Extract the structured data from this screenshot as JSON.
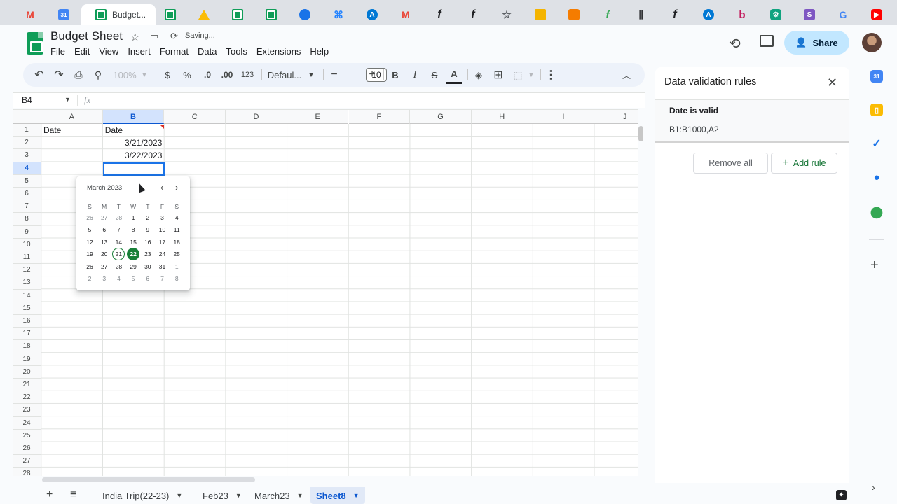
{
  "browser_tabs": [
    {
      "icon": "gmail-icon",
      "glyph": "M"
    },
    {
      "icon": "calendar-icon",
      "glyph": "31"
    },
    {
      "icon": "sheets-icon",
      "title": "Budget...",
      "active": true
    },
    {
      "icon": "sheets-icon"
    },
    {
      "icon": "drive-icon"
    },
    {
      "icon": "sheets-icon"
    },
    {
      "icon": "sheets-icon"
    },
    {
      "icon": "hexagon-icon"
    },
    {
      "icon": "jira-icon",
      "glyph": "⌘"
    },
    {
      "icon": "azure-icon",
      "glyph": "A"
    },
    {
      "icon": "gmail-icon",
      "glyph": "M"
    },
    {
      "icon": "f-icon",
      "glyph": "f"
    },
    {
      "icon": "f-icon",
      "glyph": "f"
    },
    {
      "icon": "star-icon",
      "glyph": "☆"
    },
    {
      "icon": "box-icon"
    },
    {
      "icon": "cube-icon"
    },
    {
      "icon": "green-f-icon",
      "glyph": "f"
    },
    {
      "icon": "bars-icon",
      "glyph": "⫼"
    },
    {
      "icon": "f-icon",
      "glyph": "f"
    },
    {
      "icon": "azure-icon",
      "glyph": "A"
    },
    {
      "icon": "b-icon",
      "glyph": "b"
    },
    {
      "icon": "chatgpt-icon",
      "glyph": "⚙"
    },
    {
      "icon": "s-icon",
      "glyph": "S"
    },
    {
      "icon": "google-icon",
      "glyph": "G"
    },
    {
      "icon": "youtube-icon",
      "glyph": "▶"
    }
  ],
  "doc": {
    "title": "Budget Sheet",
    "status": "Saving...",
    "menu": [
      "File",
      "Edit",
      "View",
      "Insert",
      "Format",
      "Data",
      "Tools",
      "Extensions",
      "Help"
    ],
    "share_label": "Share"
  },
  "toolbar": {
    "zoom": "100%",
    "currency": "$",
    "percent": "%",
    "decrease_decimal": ".0",
    "increase_decimal": ".00",
    "more_formats": "123",
    "font": "Defaul...",
    "font_size": "10",
    "bold": "B",
    "italic": "I",
    "strike": "S",
    "text_color": "A"
  },
  "formula_bar": {
    "cell_ref": "B4",
    "fx": "fx"
  },
  "grid": {
    "columns": [
      "A",
      "B",
      "C",
      "D",
      "E",
      "F",
      "G",
      "H",
      "I",
      "J"
    ],
    "selected_column": "B",
    "rows": [
      "1",
      "2",
      "3",
      "4",
      "5",
      "6",
      "7",
      "8",
      "9",
      "10",
      "11",
      "12",
      "13",
      "14",
      "15",
      "16",
      "17",
      "18",
      "19",
      "20",
      "21",
      "22",
      "23",
      "24",
      "25",
      "26",
      "27",
      "28"
    ],
    "selected_row": "4",
    "cells": {
      "A1": "Date",
      "B1": "Date",
      "B2": "3/21/2023",
      "B3": "3/22/2023"
    }
  },
  "date_picker": {
    "month_label": "March 2023",
    "weekdays": [
      "S",
      "M",
      "T",
      "W",
      "T",
      "F",
      "S"
    ],
    "weeks": [
      [
        [
          "26",
          1
        ],
        [
          "27",
          1
        ],
        [
          "28",
          1
        ],
        [
          "1",
          0
        ],
        [
          "2",
          0
        ],
        [
          "3",
          0
        ],
        [
          "4",
          0
        ]
      ],
      [
        [
          "5",
          0
        ],
        [
          "6",
          0
        ],
        [
          "7",
          0
        ],
        [
          "8",
          0
        ],
        [
          "9",
          0
        ],
        [
          "10",
          0
        ],
        [
          "11",
          0
        ]
      ],
      [
        [
          "12",
          0
        ],
        [
          "13",
          0
        ],
        [
          "14",
          0
        ],
        [
          "15",
          0
        ],
        [
          "16",
          0
        ],
        [
          "17",
          0
        ],
        [
          "18",
          0
        ]
      ],
      [
        [
          "19",
          0
        ],
        [
          "20",
          0
        ],
        [
          "21",
          0
        ],
        [
          "22",
          0
        ],
        [
          "23",
          0
        ],
        [
          "24",
          0
        ],
        [
          "25",
          0
        ]
      ],
      [
        [
          "26",
          0
        ],
        [
          "27",
          0
        ],
        [
          "28",
          0
        ],
        [
          "29",
          0
        ],
        [
          "30",
          0
        ],
        [
          "31",
          0
        ],
        [
          "1",
          1
        ]
      ],
      [
        [
          "2",
          1
        ],
        [
          "3",
          1
        ],
        [
          "4",
          1
        ],
        [
          "5",
          1
        ],
        [
          "6",
          1
        ],
        [
          "7",
          1
        ],
        [
          "8",
          1
        ]
      ]
    ],
    "today": "21",
    "selected": "22",
    "accent_color": "#188038"
  },
  "validation_panel": {
    "title": "Data validation rules",
    "rule_name": "Date is valid",
    "rule_range": "B1:B1000,A2",
    "remove_all_label": "Remove all",
    "add_rule_label": "Add rule"
  },
  "sheet_tabs": [
    {
      "label": "India Trip(22-23)",
      "active": false
    },
    {
      "label": "Feb23",
      "active": false
    },
    {
      "label": "March23",
      "active": false
    },
    {
      "label": "Sheet8",
      "active": true
    }
  ]
}
